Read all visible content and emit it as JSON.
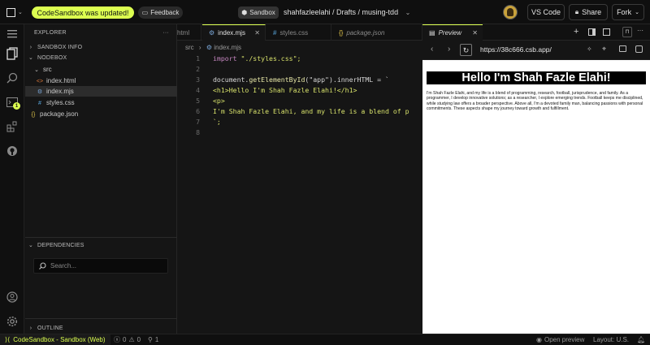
{
  "topbar": {
    "update_notice": "CodeSandbox was updated!",
    "feedback_label": "Feedback",
    "sandbox_label": "Sandbox",
    "breadcrumb": "shahfazleelahi / Drafts / musing-tdd",
    "vscode_label": "VS Code",
    "share_label": "Share",
    "fork_label": "Fork"
  },
  "explorer": {
    "title": "EXPLORER",
    "sandbox_info": "SANDBOX INFO",
    "nodebox": "NODEBOX",
    "src_folder": "src",
    "files": [
      "index.html",
      "index.mjs",
      "styles.css"
    ],
    "root_file": "package.json",
    "dependencies": "DEPENDENCIES",
    "search_placeholder": "Search...",
    "outline": "OUTLINE"
  },
  "activity": {
    "notification_count": "1"
  },
  "editor": {
    "tabs": [
      {
        "label": "html"
      },
      {
        "label": "index.mjs"
      },
      {
        "label": "styles.css"
      },
      {
        "label": "package.json"
      }
    ],
    "breadcrumb_folder": "src",
    "breadcrumb_file": "index.mjs",
    "line_numbers": [
      "1",
      "2",
      "3",
      "4",
      "5",
      "6",
      "7",
      "8"
    ],
    "code": {
      "l1_kw": "import",
      "l1_str": "\"./styles.css\";",
      "l3_a": "document.",
      "l3_fn": "getElementById",
      "l3_b": "(\"app\").innerHTML = `",
      "l4": "<h1>Hello I'm Shah Fazle Elahi!</h1>",
      "l5": "<p>",
      "l6": "I'm Shah Fazle Elahi, and my life is a blend of p",
      "l7": "`;"
    }
  },
  "preview": {
    "tab_label": "Preview",
    "url": "https://38c666.csb.app/",
    "heading": "Hello I'm Shah Fazle Elahi!",
    "paragraph": "I'm Shah Fazle Elahi, and my life is a blend of programming, research, football, jurisprudence, and family. As a programmer, I develop innovative solutions; as a researcher, I explore emerging trends. Football keeps me disciplined, while studying law offers a broader perspective. Above all, I'm a devoted family man, balancing passions with personal commitments. These aspects shape my journey toward growth and fulfillment."
  },
  "status": {
    "env_label": "CodeSandbox - Sandbox (Web)",
    "errors": "0",
    "warnings": "0",
    "ports": "1",
    "open_preview": "Open preview",
    "layout": "Layout: U.S."
  },
  "colors": {
    "accent": "#dcff50",
    "background": "#151515"
  }
}
